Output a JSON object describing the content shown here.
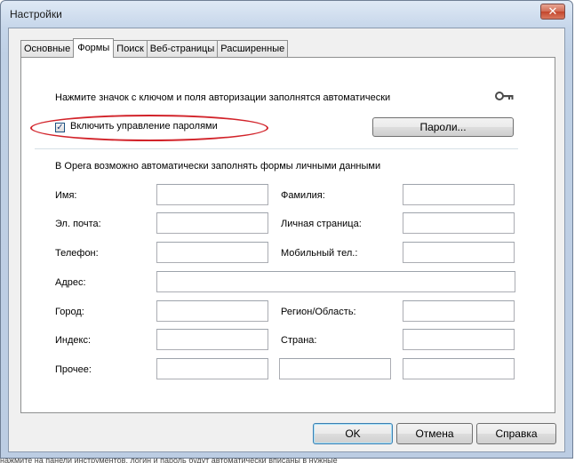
{
  "window": {
    "title": "Настройки",
    "close_symbol": "✕"
  },
  "tabs": [
    {
      "label": "Основные",
      "active": false
    },
    {
      "label": "Формы",
      "active": true
    },
    {
      "label": "Поиск",
      "active": false
    },
    {
      "label": "Веб-страницы",
      "active": false
    },
    {
      "label": "Расширенные",
      "active": false
    }
  ],
  "autofill": {
    "hint": "Нажмите значок с ключом и поля авторизации заполнятся автоматически",
    "enable_passwords_label": "Включить управление паролями",
    "enable_passwords_checked": true,
    "passwords_button": "Пароли..."
  },
  "personal": {
    "intro": "В Opera возможно автоматически заполнять формы личными данными",
    "labels": {
      "first_name": "Имя:",
      "last_name": "Фамилия:",
      "email": "Эл. почта:",
      "homepage": "Личная страница:",
      "phone": "Телефон:",
      "mobile": "Мобильный тел.:",
      "address": "Адрес:",
      "city": "Город:",
      "region": "Регион/Область:",
      "zip": "Индекс:",
      "country": "Страна:",
      "other": "Прочее:"
    },
    "values": {
      "first_name": "",
      "last_name": "",
      "email": "",
      "homepage": "",
      "phone": "",
      "mobile": "",
      "address": "",
      "city": "",
      "region": "",
      "zip": "",
      "country": "",
      "other_1": "",
      "other_2": "",
      "other_3": ""
    }
  },
  "footer": {
    "ok": "OK",
    "cancel": "Отмена",
    "help": "Справка"
  },
  "annotation": {
    "highlight_color": "#d2232a"
  },
  "background_caption": "нажмите на панели инструментов, логин и пароль будут автоматически вписаны в нужные"
}
